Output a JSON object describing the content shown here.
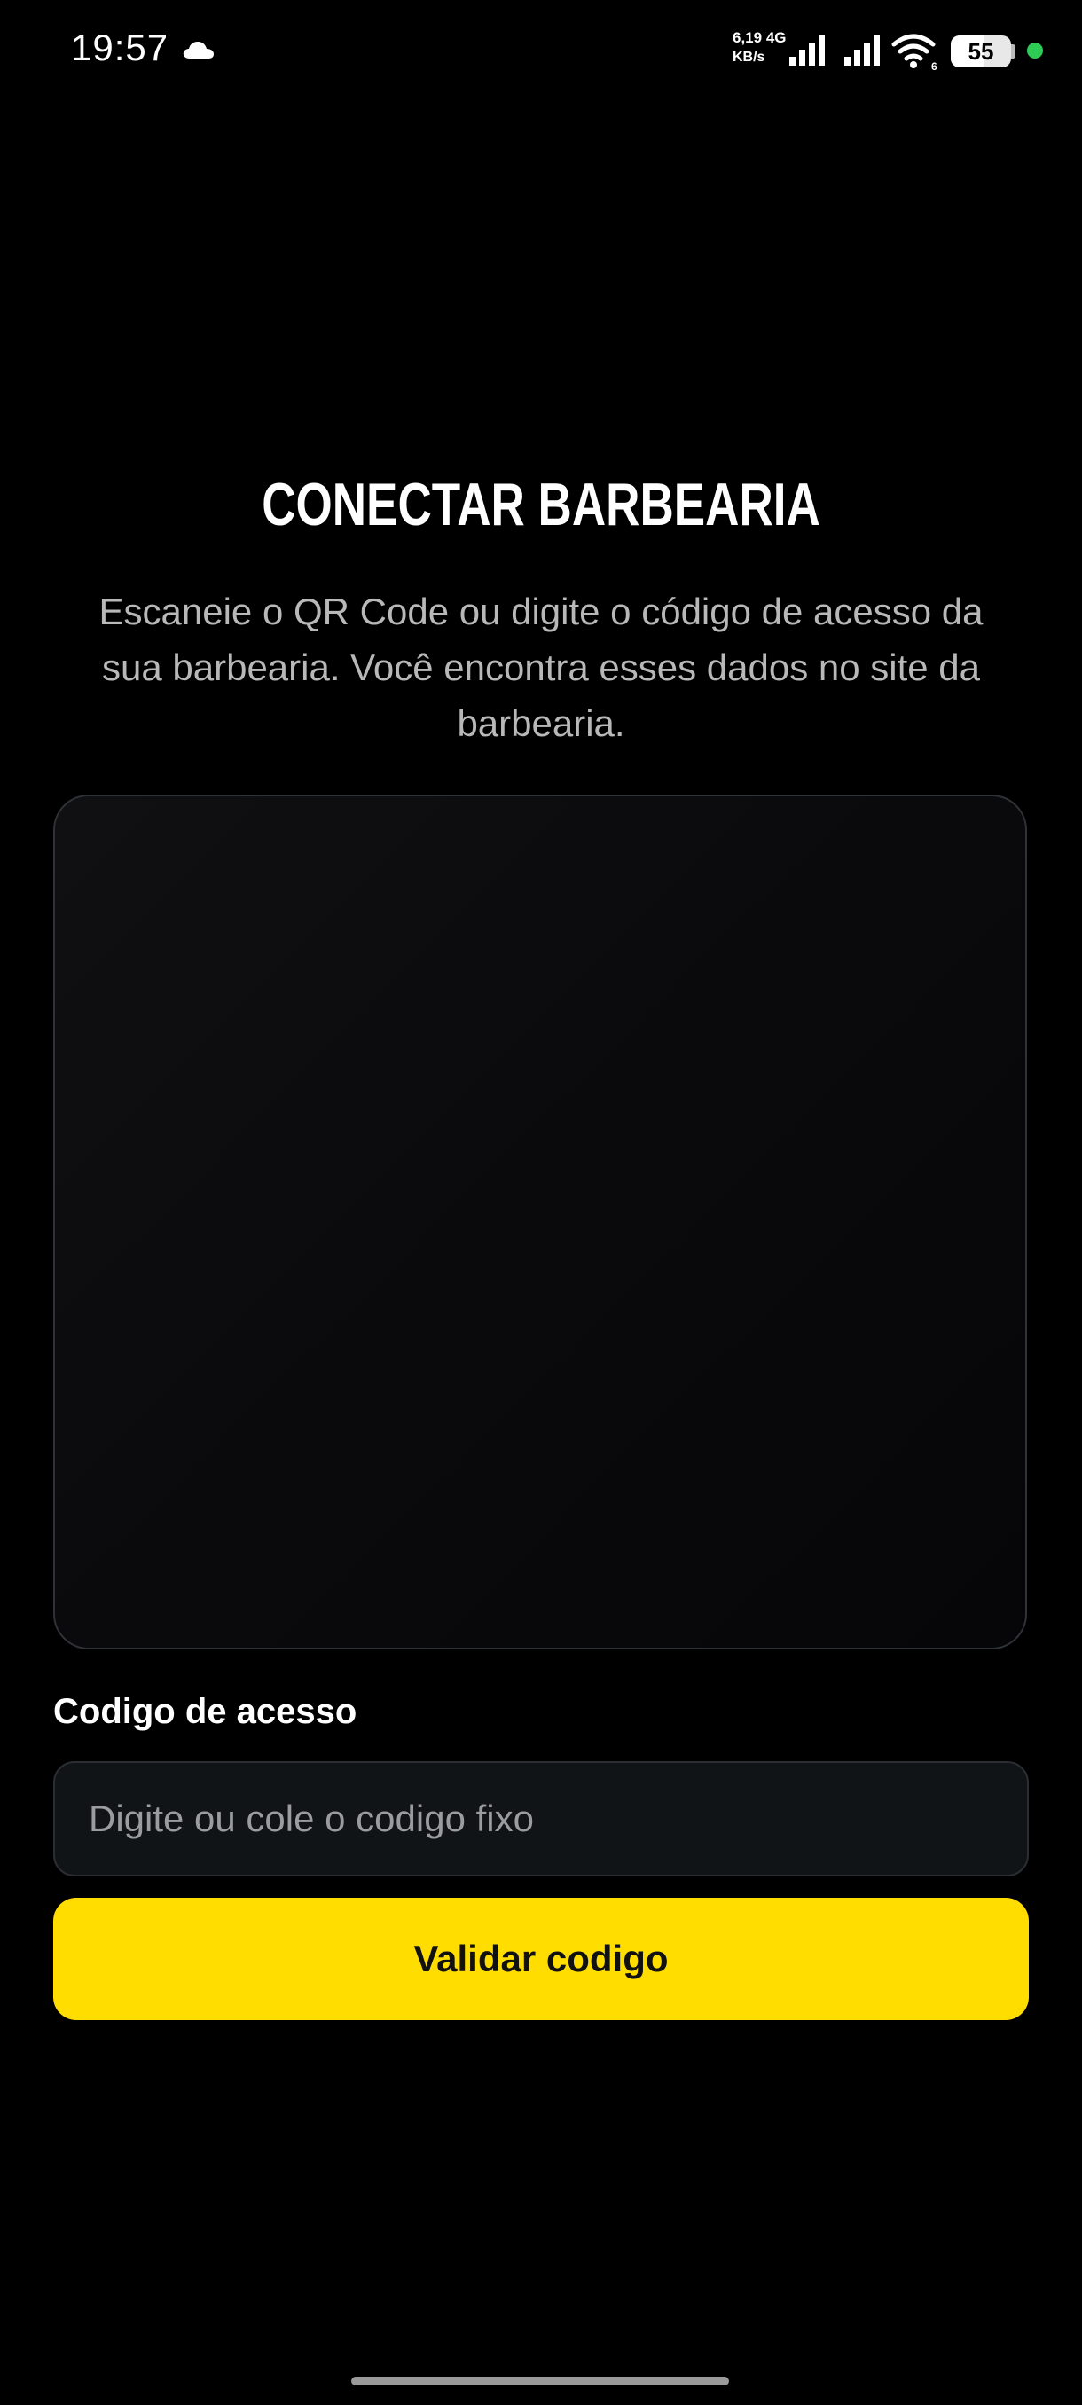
{
  "status_bar": {
    "time": "19:57",
    "net_speed_value": "6,19",
    "net_type": "4G",
    "net_speed_unit": "KB/s",
    "wifi_badge": "6",
    "battery_percent": "55",
    "battery_level": 0.55
  },
  "screen": {
    "title": "CONECTAR BARBEARIA",
    "subtitle": "Escaneie o QR Code ou digite o código de acesso da sua barbearia. Você encontra esses dados no site da barbearia."
  },
  "form": {
    "code_label": "Codigo de acesso",
    "code_value": "",
    "code_placeholder": "Digite ou cole o codigo fixo",
    "validate_label": "Validar codigo"
  },
  "colors": {
    "background": "#000000",
    "accent": "#ffdd00",
    "status_dot": "#2ecc55"
  }
}
